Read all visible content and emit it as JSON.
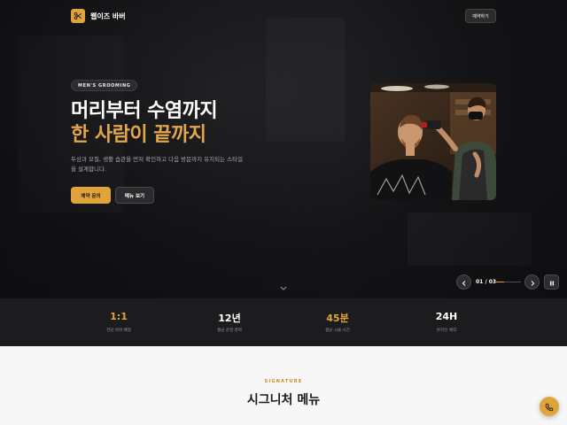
{
  "header": {
    "brand": "웹이즈 바버",
    "reserve_label": "예약하기"
  },
  "hero": {
    "badge": "MEN'S GROOMING",
    "title_line1": "머리부터 수염까지",
    "title_line2": "한 사람이 끝까지",
    "description": "두상과 모질, 생활 습관을 먼저 확인하고 다음 방문까지 유지되는 스타일을 설계합니다.",
    "primary_cta": "예약 문의",
    "secondary_cta": "메뉴 보기"
  },
  "slider": {
    "counter": "01 / 03",
    "progress": 0.33
  },
  "stats": [
    {
      "value": "1:1",
      "label": "전담 바버 배정",
      "highlight": true
    },
    {
      "value": "12년",
      "label": "평균 운영 경력",
      "highlight": false
    },
    {
      "value": "45분",
      "label": "평균 시술 시간",
      "highlight": true
    },
    {
      "value": "24H",
      "label": "온라인 예약",
      "highlight": false
    }
  ],
  "signature": {
    "eyebrow": "SIGNATURE",
    "title": "시그니처 메뉴"
  },
  "icons": {
    "logo": "scissors-icon",
    "scroll": "chevron-down-icon",
    "prev": "chevron-left-icon",
    "next": "chevron-right-icon",
    "pause": "pause-icon",
    "fab": "phone-icon"
  },
  "colors": {
    "accent": "#e0a43a",
    "hero_bg": "#17171a",
    "stats_bg": "#1c1c1f"
  }
}
